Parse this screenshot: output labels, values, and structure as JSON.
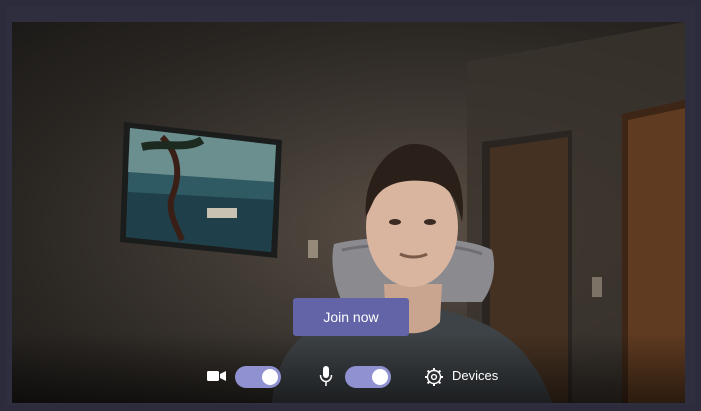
{
  "prejoin": {
    "join_label": "Join now",
    "camera": {
      "icon": "video-camera-icon",
      "state": "on"
    },
    "microphone": {
      "icon": "microphone-icon",
      "state": "on"
    },
    "devices": {
      "icon": "gear-icon",
      "label": "Devices"
    }
  },
  "colors": {
    "accent": "#6264a7",
    "toggle_on": "#8f91d1",
    "frame": "#2d2c3c"
  }
}
